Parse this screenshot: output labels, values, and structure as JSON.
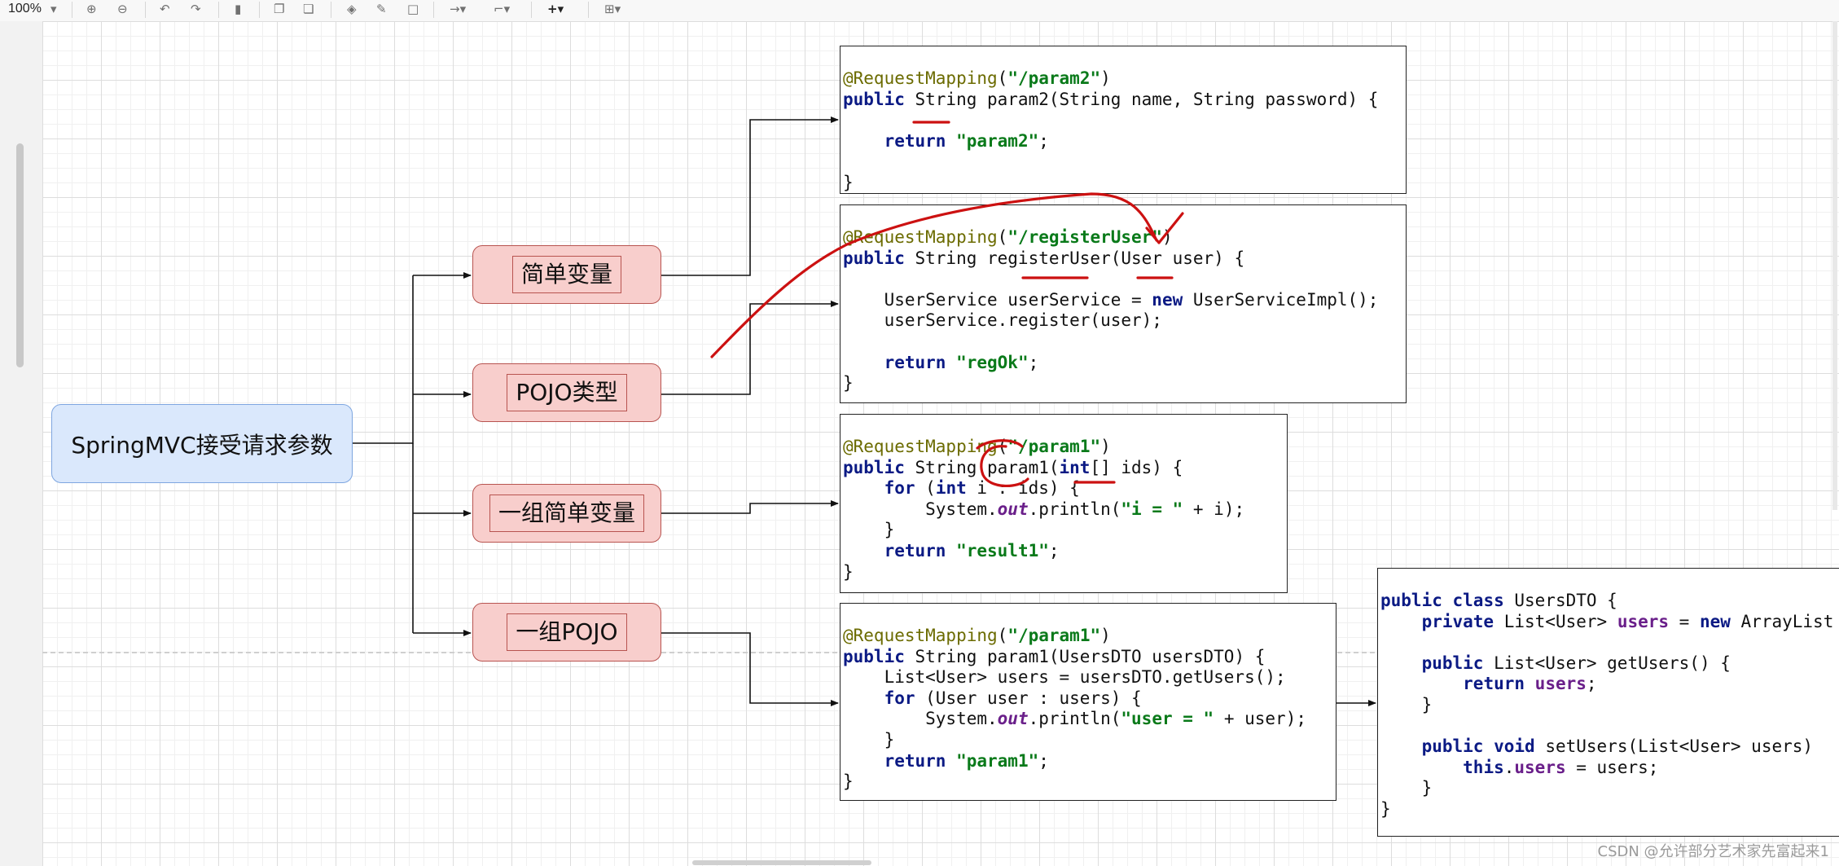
{
  "toolbar": {
    "zoom": "100%",
    "icons": [
      "zoom-in-icon",
      "zoom-out-icon",
      "undo-icon",
      "redo-icon",
      "delete-icon",
      "to-front-icon",
      "to-back-icon",
      "fill-color-icon",
      "line-color-icon",
      "shadow-icon",
      "connection-icon",
      "waypoints-icon",
      "insert-icon",
      "table-icon"
    ]
  },
  "diagram": {
    "root": "SpringMVC接受请求参数",
    "branches": [
      "简单变量",
      "POJO类型",
      "一组简单变量",
      "一组POJO"
    ],
    "colors": {
      "root_fill": "#dae8fc",
      "root_border": "#7ea6e0",
      "branch_fill": "#f8cecc",
      "branch_border": "#b85450",
      "annotation_ink": "#cc1111"
    }
  },
  "code_blocks": {
    "param2": [
      "@RequestMapping(\"/param2\")",
      "public String param2(String name, String password) {",
      "",
      "    return \"param2\";",
      "",
      "}"
    ],
    "register": [
      "@RequestMapping(\"/registerUser\")",
      "public String registerUser(User user) {",
      "",
      "    UserService userService = new UserServiceImpl();",
      "    userService.register(user);",
      "",
      "    return \"regOk\";",
      "}"
    ],
    "param1_ints": [
      "@RequestMapping(\"/param1\")",
      "public String param1(int[] ids) {",
      "    for (int i : ids) {",
      "        System.out.println(\"i = \" + i);",
      "    }",
      "    return \"result1\";",
      "}"
    ],
    "param1_dto": [
      "@RequestMapping(\"/param1\")",
      "public String param1(UsersDTO usersDTO) {",
      "    List<User> users = usersDTO.getUsers();",
      "    for (User user : users) {",
      "        System.out.println(\"user = \" + user);",
      "    }",
      "    return \"param1\";",
      "}"
    ],
    "users_dto": [
      "public class UsersDTO {",
      "    private List<User> users = new ArrayList",
      "",
      "    public List<User> getUsers() {",
      "        return users;",
      "    }",
      "",
      "    public void setUsers(List<User> users)",
      "        this.users = users;",
      "    }",
      "}"
    ]
  },
  "watermark": "CSDN @允许部分艺术家先富起来1"
}
